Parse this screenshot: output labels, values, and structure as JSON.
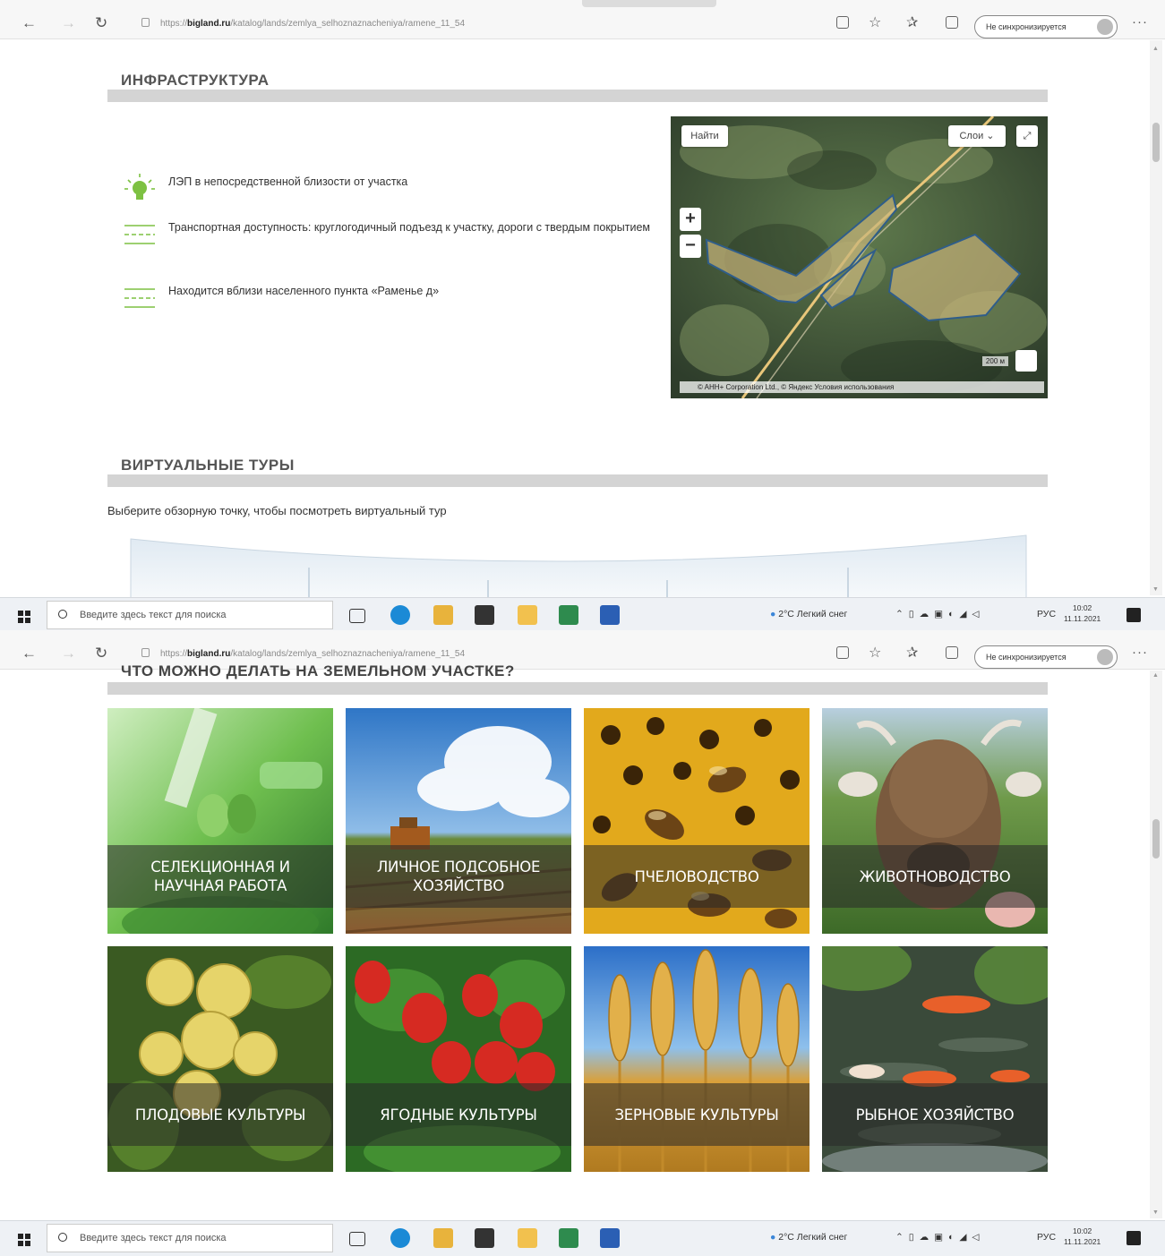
{
  "browser": {
    "url_scheme": "https://",
    "url_host": "bigland.ru",
    "url_path": "/katalog/lands/zemlya_selhoznaznacheniya/ramene_11_54",
    "sync_label": "Не синхронизируется"
  },
  "infrastructure": {
    "title": "ИНФРАСТРУКТУРА",
    "items": [
      {
        "text": "ЛЭП в непосредственной близости от участка",
        "icon": "lightbulb-icon"
      },
      {
        "text": "Транспортная доступность: круглогодичный подъезд к участку, дороги с твердым покрытием",
        "icon": "road-icon"
      },
      {
        "text": "Находится вблизи населенного пункта «Раменье д»",
        "icon": "road-icon"
      }
    ],
    "map": {
      "find_label": "Найти",
      "layers_label": "Слои",
      "zoom_in": "+",
      "zoom_out": "−",
      "scale_label": "200 м",
      "copyright": "© AHH+ Corporation Ltd., © Яндекс Условия использования"
    }
  },
  "virtual_tours": {
    "title": "ВИРТУАЛЬНЫЕ ТУРЫ",
    "intro": "Выберите обзорную точку, чтобы посмотреть виртуальный тур"
  },
  "activities": {
    "title": "ЧТО МОЖНО ДЕЛАТЬ НА ЗЕМЕЛЬНОМ УЧАСТКЕ?",
    "tiles": [
      {
        "label": "Селекционная и научная работа"
      },
      {
        "label": "Личное подсобное хозяйство"
      },
      {
        "label": "Пчеловодство"
      },
      {
        "label": "Животноводство"
      },
      {
        "label": "Плодовые культуры"
      },
      {
        "label": "Ягодные культуры"
      },
      {
        "label": "Зерновые культуры"
      },
      {
        "label": "Рыбное хозяйство"
      }
    ]
  },
  "taskbar": {
    "search_placeholder": "Введите здесь текст для поиска",
    "weather": "2°C Легкий снег",
    "lang": "РУС",
    "time": "10:02",
    "date": "11.11.2021"
  },
  "colors": {
    "accent_green": "#7dc142",
    "section_bar": "#d4d4d4"
  }
}
